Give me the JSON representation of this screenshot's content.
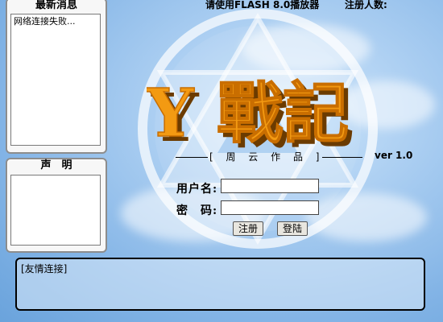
{
  "header": {
    "player_notice": "请使用FLASH 8.0播放器",
    "registered_label": "注册人数:"
  },
  "news_panel": {
    "title": "最新消息",
    "content": "网络连接失败..."
  },
  "statement_panel": {
    "title": "声　明",
    "content": ""
  },
  "logo": {
    "text": "Y 戰記",
    "subtitle": "[ 周 云 作 品 ]",
    "version": "ver 1.0"
  },
  "login": {
    "username_label": "用户名:",
    "password_label": "密　码:",
    "username_value": "",
    "password_value": "",
    "register_button": "注册",
    "login_button": "登陆"
  },
  "links_panel": {
    "title": "[友情连接]"
  },
  "colors": {
    "logo_orange": "#f39a12",
    "logo_shadow": "#6b3b00",
    "sky": "#83b4e6"
  }
}
